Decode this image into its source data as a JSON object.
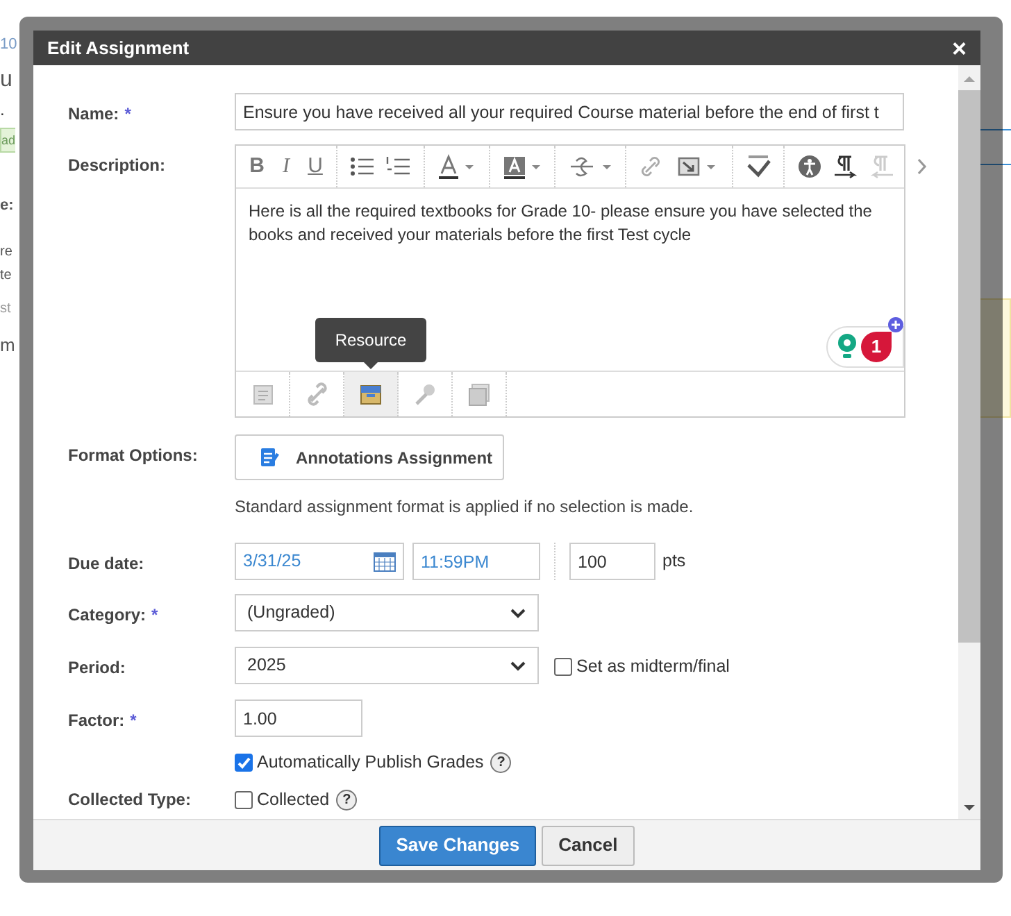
{
  "background_page": {
    "left_fragments": [
      "10",
      "u",
      ".",
      "ad",
      "e:",
      "re",
      "te",
      "st",
      "m"
    ]
  },
  "dialog": {
    "title": "Edit Assignment",
    "close": "×",
    "name": {
      "label": "Name:",
      "required_marker": "*",
      "value": "Ensure you have received all your required Course material before the end of first t"
    },
    "description": {
      "label": "Description:",
      "format_buttons": [
        "B",
        "I",
        "U"
      ],
      "text": "Here is all the required textbooks for Grade 10- please ensure you have selected the books and received your materials before the first Test cycle",
      "tooltip": "Resource",
      "assistant_badge": "1",
      "media_toolbar": [
        {
          "selected": false
        },
        {
          "selected": false
        },
        {
          "selected": true
        },
        {
          "selected": false
        },
        {
          "selected": false
        }
      ]
    },
    "format_options": {
      "label": "Format Options:",
      "button": "Annotations Assignment",
      "hint": "Standard assignment format is applied if no selection is made."
    },
    "due_date": {
      "label": "Due date:",
      "date": "3/31/25",
      "time": "11:59PM",
      "points": "100",
      "points_unit": "pts"
    },
    "category": {
      "label": "Category:",
      "required_marker": "*",
      "value": "(Ungraded)"
    },
    "period": {
      "label": "Period:",
      "value": "2025",
      "midterm_checkbox": {
        "label": "Set as midterm/final",
        "checked": false
      }
    },
    "factor": {
      "label": "Factor:",
      "required_marker": "*",
      "value": "1.00"
    },
    "publish_checkbox": {
      "label": "Automatically Publish Grades",
      "checked": true,
      "help": "?"
    },
    "collected_type": {
      "label": "Collected Type:",
      "checkbox": {
        "label": "Collected",
        "checked": false,
        "help": "?"
      }
    },
    "buttons": [
      {
        "label": "Save Changes",
        "kind": "primary"
      },
      {
        "label": "Cancel",
        "kind": "secondary"
      }
    ]
  }
}
